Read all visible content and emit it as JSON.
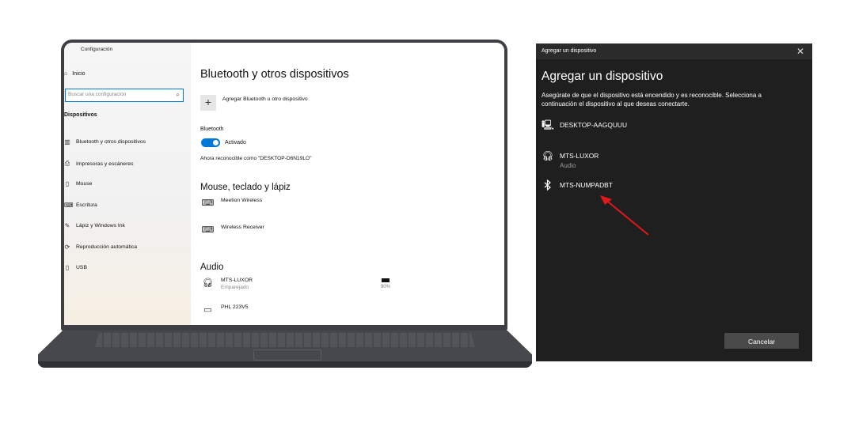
{
  "laptop": {
    "sidebar": {
      "app_title": "Configuración",
      "home": "Inicio",
      "search_placeholder": "Buscar una configuración",
      "section": "Dispositivos",
      "items": [
        {
          "label": "Bluetooth y otros dispositivos",
          "icon": "bluetooth-devices-icon"
        },
        {
          "label": "Impresoras y escáneres",
          "icon": "printer-icon"
        },
        {
          "label": "Mouse",
          "icon": "mouse-icon"
        },
        {
          "label": "Escritura",
          "icon": "keyboard-icon"
        },
        {
          "label": "Lápiz y Windows Ink",
          "icon": "pen-icon"
        },
        {
          "label": "Reproducción automática",
          "icon": "autoplay-icon"
        },
        {
          "label": "USB",
          "icon": "usb-icon"
        }
      ]
    },
    "main": {
      "title": "Bluetooth y otros dispositivos",
      "add_label": "Agregar Bluetooth u otro dispositivo",
      "bluetooth_label": "Bluetooth",
      "toggle_label": "Activado",
      "toggle_on": true,
      "discoverable": "Ahora reconocible como \"DESKTOP-D6N19LO\"",
      "mouse_section": "Mouse, teclado y lápiz",
      "mouse_devices": [
        {
          "name": "Meetion Wireless",
          "icon": "keyboard-icon"
        },
        {
          "name": "Wireless Receiver",
          "icon": "keyboard-icon"
        }
      ],
      "audio_section": "Audio",
      "audio_devices": [
        {
          "name": "MTS-LUXOR",
          "status": "Emparejado",
          "battery": "90%",
          "icon": "headset-icon"
        },
        {
          "name": "PHL 223V5",
          "icon": "monitor-icon"
        }
      ]
    }
  },
  "dialog": {
    "bar_title": "Agregar un dispositivo",
    "heading": "Agregar un dispositivo",
    "description": "Asegúrate de que el dispositivo está encendido y es reconocible. Selecciona a continuación el dispositivo al que deseas conectarte.",
    "devices": [
      {
        "name": "DESKTOP-AAGQUUU",
        "sub": "",
        "icon": "computer-icon"
      },
      {
        "name": "MTS-LUXOR",
        "sub": "Audio",
        "icon": "headset-icon"
      },
      {
        "name": "MTS-NUMPADBT",
        "sub": "",
        "icon": "bluetooth-icon"
      }
    ],
    "cancel_label": "Cancelar"
  },
  "colors": {
    "accent": "#0078d7",
    "dialog_bg": "#1f1f1f",
    "arrow": "#e0191b"
  }
}
